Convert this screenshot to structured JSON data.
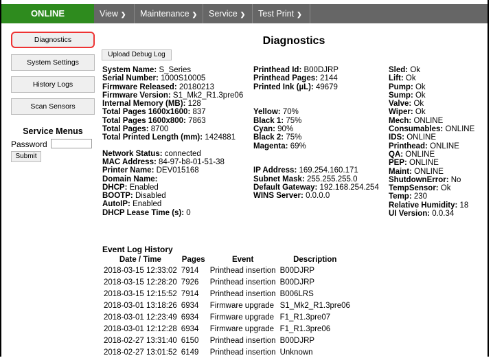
{
  "topbar": {
    "status": "ONLINE",
    "menus": [
      "View",
      "Maintenance",
      "Service",
      "Test Print"
    ]
  },
  "sidebar": {
    "buttons": [
      "Diagnostics",
      "System Settings",
      "History Logs",
      "Scan Sensors"
    ],
    "service_menus_title": "Service Menus",
    "password_label": "Password",
    "password_value": "",
    "submit_label": "Submit"
  },
  "main": {
    "title": "Diagnostics",
    "upload_label": "Upload Debug Log",
    "col1": [
      {
        "label": "System Name:",
        "value": "S_Series"
      },
      {
        "label": "Serial Number:",
        "value": "1000S10005"
      },
      {
        "label": "Firmware Released:",
        "value": "20180213"
      },
      {
        "label": "Firmware Version:",
        "value": "S1_Mk2_R1.3pre06"
      },
      {
        "label": "Internal Memory (MB):",
        "value": "128"
      },
      {
        "label": "Total Pages 1600x1600:",
        "value": "837"
      },
      {
        "label": "Total Pages 1600x800:",
        "value": "7863"
      },
      {
        "label": "Total Pages:",
        "value": "8700"
      },
      {
        "label": "Total Printed Length (mm):",
        "value": "1424881"
      },
      {
        "label": "Network Status:",
        "value": "connected"
      },
      {
        "label": "MAC Address:",
        "value": "84-97-b8-01-51-38"
      },
      {
        "label": "Printer Name:",
        "value": "DEV015168"
      },
      {
        "label": "Domain Name:",
        "value": ""
      },
      {
        "label": "DHCP:",
        "value": "Enabled"
      },
      {
        "label": "BOOTP:",
        "value": "Disabled"
      },
      {
        "label": "AutoIP:",
        "value": "Enabled"
      },
      {
        "label": "DHCP Lease Time (s):",
        "value": "0"
      }
    ],
    "col2": [
      {
        "label": "Printhead Id:",
        "value": "B00DJRP"
      },
      {
        "label": "Printhead Pages:",
        "value": "2144"
      },
      {
        "label": "Printed Ink (µL):",
        "value": "49679"
      },
      {
        "label": "Yellow:",
        "value": "70%"
      },
      {
        "label": "Black 1:",
        "value": "75%"
      },
      {
        "label": "Cyan:",
        "value": "90%"
      },
      {
        "label": "Black 2:",
        "value": "75%"
      },
      {
        "label": "Magenta:",
        "value": "69%"
      },
      {
        "label": "IP Address:",
        "value": "169.254.160.171"
      },
      {
        "label": "Subnet Mask:",
        "value": "255.255.255.0"
      },
      {
        "label": "Default Gateway:",
        "value": "192.168.254.254"
      },
      {
        "label": "WINS Server:",
        "value": "0.0.0.0"
      }
    ],
    "col3": [
      {
        "label": "Sled:",
        "value": "Ok"
      },
      {
        "label": "Lift:",
        "value": "Ok"
      },
      {
        "label": "Pump:",
        "value": "Ok"
      },
      {
        "label": "Sump:",
        "value": "Ok"
      },
      {
        "label": "Valve:",
        "value": "Ok"
      },
      {
        "label": "Wiper:",
        "value": "Ok"
      },
      {
        "label": "Mech:",
        "value": "ONLINE"
      },
      {
        "label": "Consumables:",
        "value": "ONLINE"
      },
      {
        "label": "IDS:",
        "value": "ONLINE"
      },
      {
        "label": "Printhead:",
        "value": "ONLINE"
      },
      {
        "label": "QA:",
        "value": "ONLINE"
      },
      {
        "label": "PEP:",
        "value": "ONLINE"
      },
      {
        "label": "Maint:",
        "value": "ONLINE"
      },
      {
        "label": "ShutdownError:",
        "value": "No"
      },
      {
        "label": "TempSensor:",
        "value": "Ok"
      },
      {
        "label": "Temp:",
        "value": "230"
      },
      {
        "label": "Relative Humidity:",
        "value": "18"
      },
      {
        "label": "UI Version:",
        "value": "0.0.34"
      }
    ],
    "event_log": {
      "title": "Event Log History",
      "headers": [
        "Date / Time",
        "Pages",
        "Event",
        "Description"
      ],
      "rows": [
        [
          "2018-03-15 12:33:02",
          "7914",
          "Printhead insertion",
          "B00DJRP"
        ],
        [
          "2018-03-15 12:28:20",
          "7926",
          "Printhead insertion",
          "B00DJRP"
        ],
        [
          "2018-03-15 12:15:52",
          "7914",
          "Printhead insertion",
          "B006LRS"
        ],
        [
          "2018-03-01 13:18:26",
          "6934",
          "Firmware upgrade",
          "S1_Mk2_R1.3pre06"
        ],
        [
          "2018-03-01 12:23:49",
          "6934",
          "Firmware upgrade",
          "F1_R1.3pre07"
        ],
        [
          "2018-03-01 12:12:28",
          "6934",
          "Firmware upgrade",
          "F1_R1.3pre06"
        ],
        [
          "2018-02-27 13:31:40",
          "6150",
          "Printhead insertion",
          "B00DJRP"
        ],
        [
          "2018-02-27 13:01:52",
          "6149",
          "Printhead insertion",
          "Unknown"
        ]
      ]
    }
  }
}
